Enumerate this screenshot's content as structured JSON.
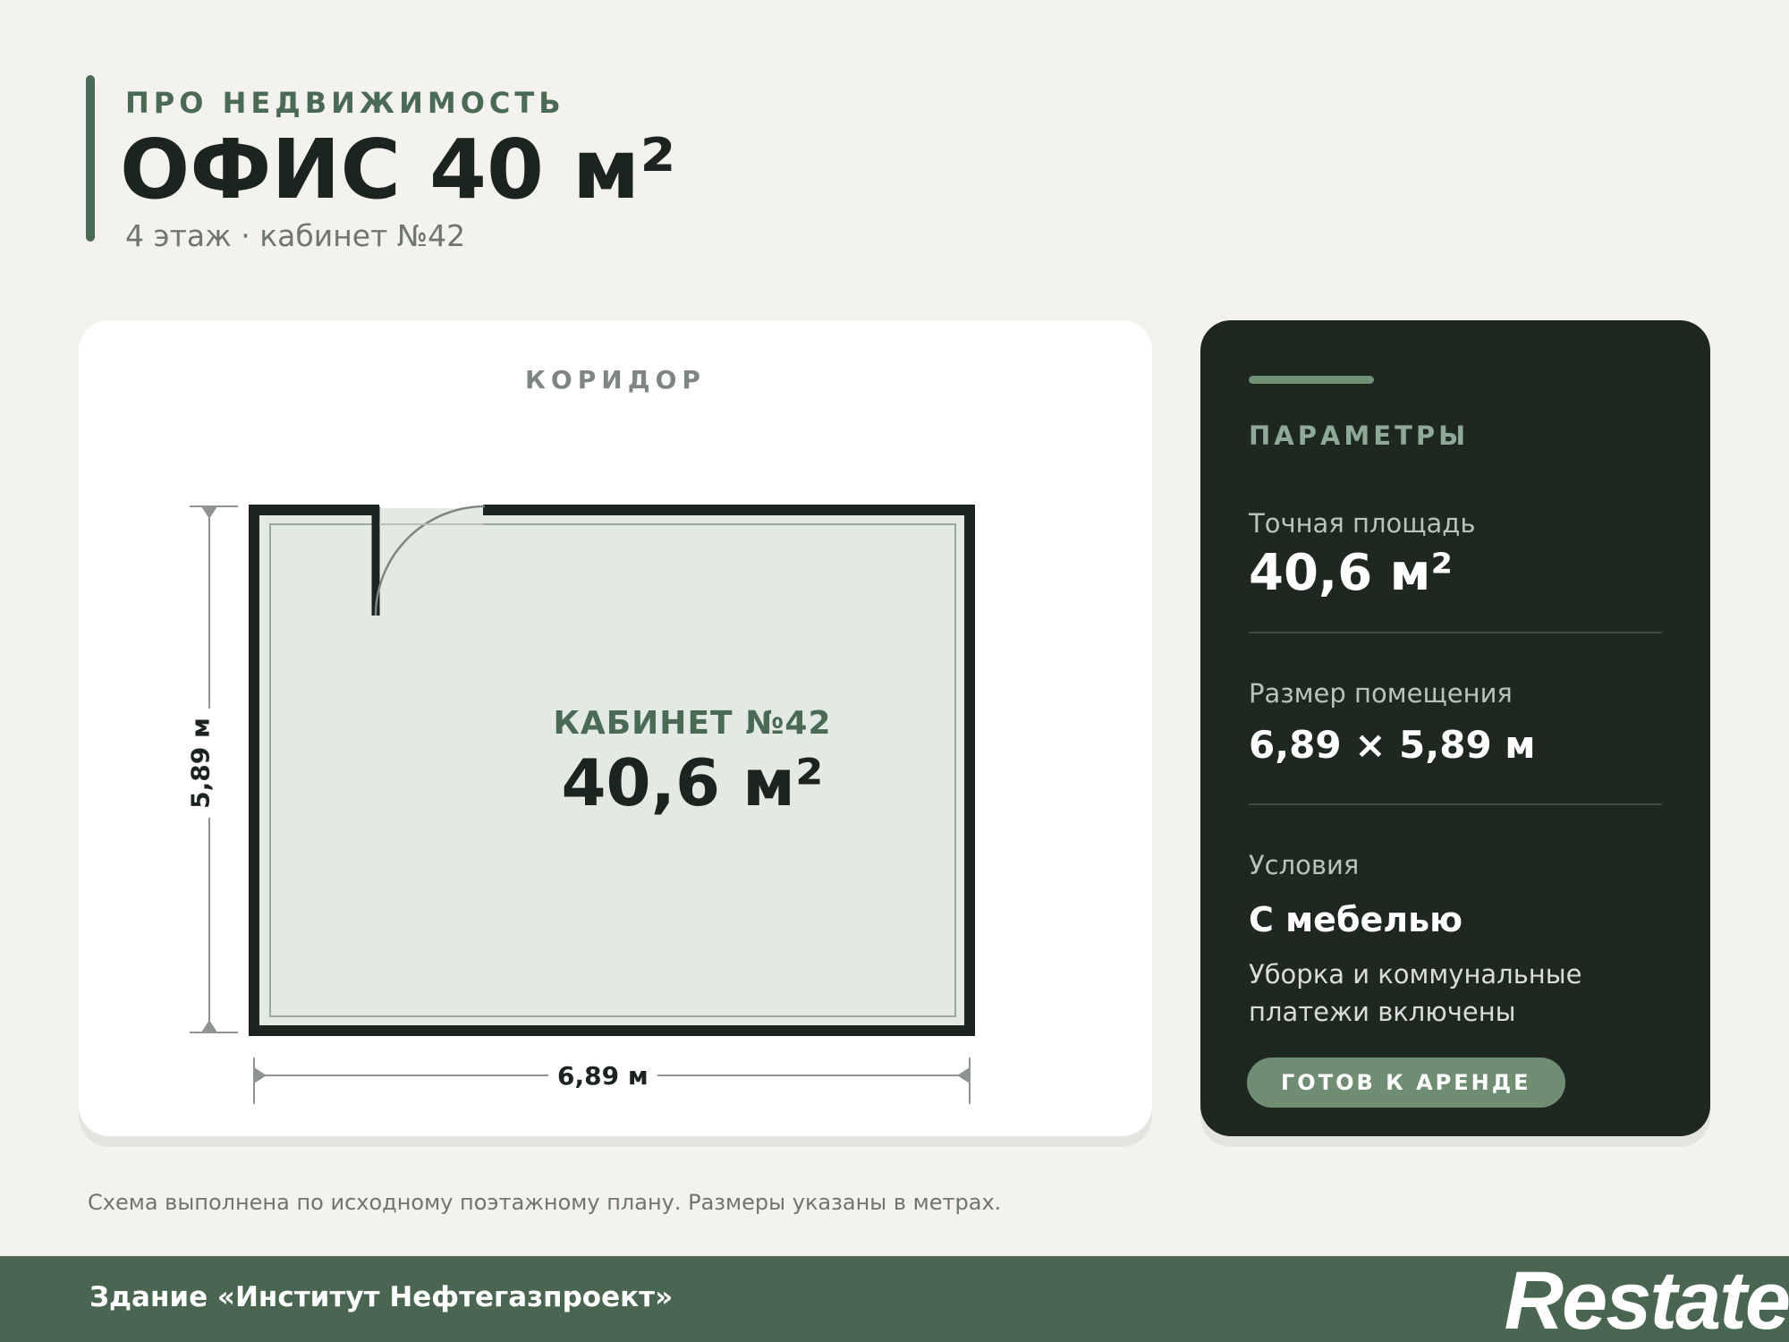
{
  "header": {
    "eyebrow": "ПРО НЕДВИЖИМОСТЬ",
    "title": "ОФИС 40 м²",
    "subtitle": "4 этаж · кабинет №42"
  },
  "plan": {
    "corridor_label": "КОРИДОР",
    "room_name": "КАБИНЕТ №42",
    "room_area": "40,6 м²",
    "width_label": "6,89 м",
    "height_label": "5,89 м"
  },
  "params": {
    "heading": "ПАРАМЕТРЫ",
    "area_label": "Точная площадь",
    "area_value": "40,6 м²",
    "size_label": "Размер помещения",
    "size_value": "6,89 × 5,89 м",
    "terms_label": "Условия",
    "terms_value": "С мебелью",
    "terms_note": "Уборка и коммунальные платежи включены",
    "status_badge": "ГОТОВ К АРЕНДЕ"
  },
  "footnote": "Схема выполнена по исходному поэтажному плану. Размеры указаны в метрах.",
  "footer": {
    "building": "Здание «Институт Нефтегазпроект»",
    "logo_text": "Restate"
  },
  "colors": {
    "accent": "#4b6a54",
    "panel": "#1f2721",
    "room_fill": "#e3eae4",
    "footer": "#4a6550"
  }
}
